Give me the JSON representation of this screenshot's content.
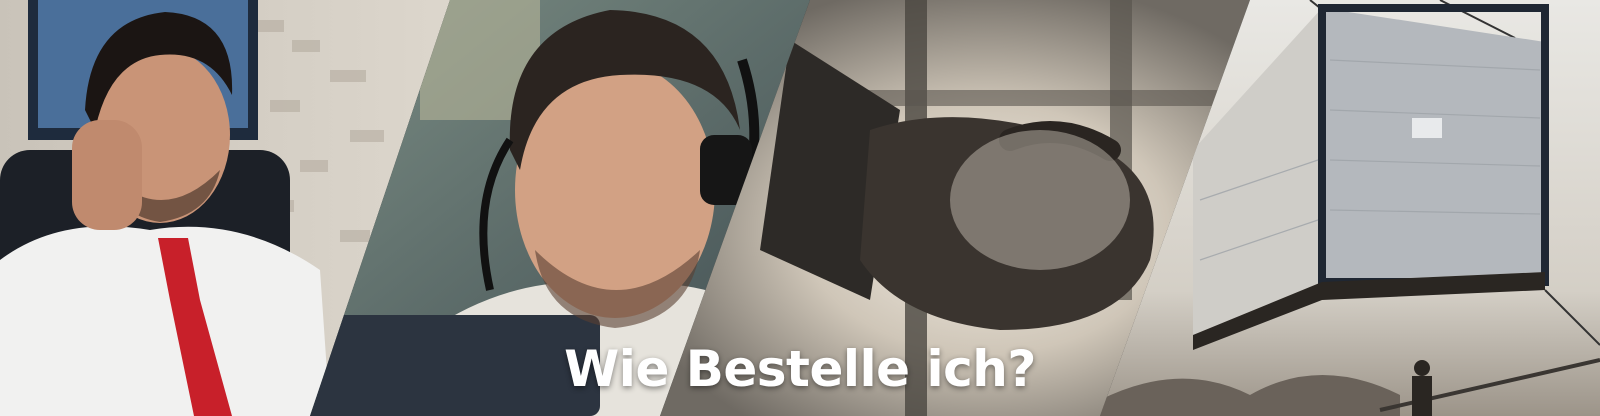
{
  "banner": {
    "headline": "Wie Bestelle ich?"
  },
  "panels": [
    {
      "scene": "man-on-phone-in-office"
    },
    {
      "scene": "man-with-headset-at-laptop"
    },
    {
      "scene": "hand-holding-phone-backlit"
    },
    {
      "scene": "wrapped-container-on-crane"
    }
  ],
  "colors": {
    "headline_text": "#ffffff",
    "tie_red": "#c8202a",
    "sky": "#d9d6cf"
  }
}
